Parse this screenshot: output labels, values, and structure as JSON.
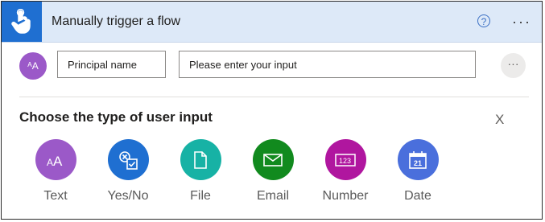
{
  "header": {
    "title": "Manually trigger a flow",
    "help_symbol": "?",
    "more_symbol": "···"
  },
  "input_row": {
    "avatar_text": "ᴬA",
    "name_field_value": "Principal name",
    "input_placeholder": "Please enter your input",
    "more_symbol": "···"
  },
  "input_types": {
    "title": "Choose the type of user input",
    "close_label": "X",
    "options": [
      {
        "label": "Text",
        "color": "#9b59c8",
        "icon": "text-icon"
      },
      {
        "label": "Yes/No",
        "color": "#1f6fd1",
        "icon": "yes-no-icon"
      },
      {
        "label": "File",
        "color": "#17b2a5",
        "icon": "file-icon"
      },
      {
        "label": "Email",
        "color": "#118a1e",
        "icon": "email-icon"
      },
      {
        "label": "Number",
        "color": "#b0169f",
        "icon": "number-icon"
      },
      {
        "label": "Date",
        "color": "#4a6fdc",
        "icon": "date-icon",
        "icon_text": "21"
      }
    ]
  },
  "colors": {
    "header_bg": "#dde9f8",
    "accent": "#1f6fd1"
  }
}
